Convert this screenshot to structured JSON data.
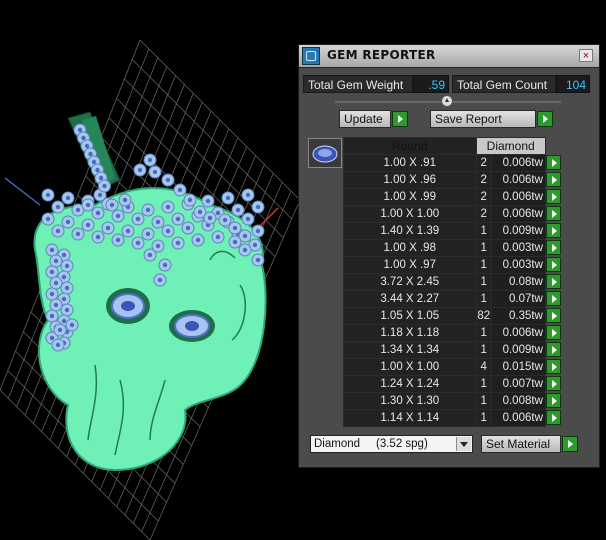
{
  "panel": {
    "title": "GEM REPORTER",
    "close_glyph": "×",
    "total_weight_label": "Total Gem Weight",
    "total_weight_value": ".59",
    "total_count_label": "Total Gem Count",
    "total_count_value": "104",
    "update_label": "Update",
    "save_label": "Save Report",
    "table": {
      "headers": [
        "Round",
        "Diamond"
      ],
      "rows": [
        {
          "size": "1.00 X .91",
          "qty": "2",
          "weight": "0.006tw"
        },
        {
          "size": "1.00 X .96",
          "qty": "2",
          "weight": "0.006tw"
        },
        {
          "size": "1.00 X .99",
          "qty": "2",
          "weight": "0.006tw"
        },
        {
          "size": "1.00 X 1.00",
          "qty": "2",
          "weight": "0.006tw"
        },
        {
          "size": "1.40 X 1.39",
          "qty": "1",
          "weight": "0.009tw"
        },
        {
          "size": "1.00 X .98",
          "qty": "1",
          "weight": "0.003tw"
        },
        {
          "size": "1.00 X .97",
          "qty": "1",
          "weight": "0.003tw"
        },
        {
          "size": "3.72 X 2.45",
          "qty": "1",
          "weight": "0.08tw"
        },
        {
          "size": "3.44 X 2.27",
          "qty": "1",
          "weight": "0.07tw"
        },
        {
          "size": "1.05 X 1.05",
          "qty": "82",
          "weight": "0.35tw"
        },
        {
          "size": "1.18 X 1.18",
          "qty": "1",
          "weight": "0.006tw"
        },
        {
          "size": "1.34 X 1.34",
          "qty": "1",
          "weight": "0.009tw"
        },
        {
          "size": "1.00 X 1.00",
          "qty": "4",
          "weight": "0.015tw"
        },
        {
          "size": "1.24 X 1.24",
          "qty": "1",
          "weight": "0.007tw"
        },
        {
          "size": "1.30 X 1.30",
          "qty": "1",
          "weight": "0.008tw"
        },
        {
          "size": "1.14 X 1.14",
          "qty": "1",
          "weight": "0.006tw"
        }
      ]
    },
    "material_selected": "Diamond     (3.52 spg)",
    "set_material_label": "Set Material"
  },
  "colors": {
    "panel_bg": "#4b4b4b",
    "value_text": "#33c8ff",
    "go_button": "#2c9a2c",
    "model_body": "#6ff0b6",
    "gems": "#a6c8ec",
    "bail": "#1e6e4a"
  },
  "icons": {
    "app": "gem-reporter-icon",
    "close": "close-icon",
    "go": "play-arrow-icon",
    "thumbnail": "round-gem-icon",
    "dropdown": "chevron-down-icon"
  }
}
